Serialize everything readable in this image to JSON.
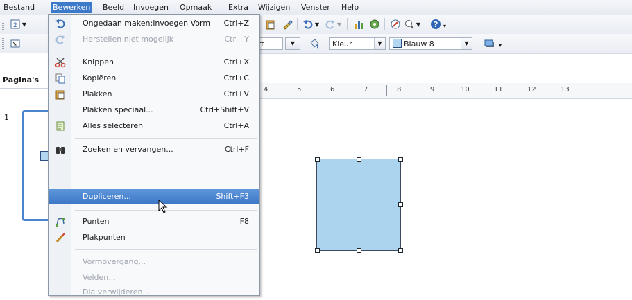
{
  "menubar": {
    "items": [
      "Bestand",
      "Bewerken",
      "Beeld",
      "Invoegen",
      "Opmaak",
      "Extra",
      "Wijzigen",
      "Venster",
      "Help"
    ]
  },
  "toolbar2": {
    "fill_style": "Kleur",
    "area_color": "Blauw 8",
    "line_style_partial": "art"
  },
  "panel": {
    "title": "Pagina's",
    "page_number": "1"
  },
  "ruler": {
    "labels": [
      "4",
      "5",
      "6",
      "7",
      "8",
      "9",
      "10",
      "11",
      "12",
      "13"
    ]
  },
  "menu": {
    "items": [
      {
        "icon": "undo-icon",
        "label": "Ongedaan maken:Invoegen Vorm",
        "shortcut": "Ctrl+Z",
        "disabled": false
      },
      {
        "icon": "redo-icon",
        "label": "Herstellen niet mogelijk",
        "shortcut": "Ctrl+Y",
        "disabled": true
      },
      {
        "icon": "scissors-icon",
        "label": "Knippen",
        "shortcut": "Ctrl+X",
        "disabled": false
      },
      {
        "icon": "copy-icon",
        "label": "Kopiëren",
        "shortcut": "Ctrl+C",
        "disabled": false
      },
      {
        "icon": "paste-icon",
        "label": "Plakken",
        "shortcut": "Ctrl+V",
        "disabled": false
      },
      {
        "icon": "",
        "label": "Plakken speciaal...",
        "shortcut": "Ctrl+Shift+V",
        "disabled": false
      },
      {
        "icon": "select-all-icon",
        "label": "Alles selecteren",
        "shortcut": "Ctrl+A",
        "disabled": false
      },
      {
        "icon": "binoculars-icon",
        "label": "Zoeken en vervangen...",
        "shortcut": "Ctrl+F",
        "disabled": false
      },
      {
        "icon": "",
        "label": "Dupliceren...",
        "shortcut": "Shift+F3",
        "disabled": false,
        "highlighted": true
      },
      {
        "icon": "points-icon",
        "label": "Punten",
        "shortcut": "F8",
        "disabled": false
      },
      {
        "icon": "glue-points-icon",
        "label": "Plakpunten",
        "shortcut": "",
        "disabled": false
      },
      {
        "icon": "",
        "label": "Vormovergang...",
        "shortcut": "",
        "disabled": true
      },
      {
        "icon": "",
        "label": "Velden...",
        "shortcut": "",
        "disabled": true
      },
      {
        "icon": "",
        "label": "Dia verwijderen...",
        "shortcut": "",
        "disabled": true
      }
    ]
  }
}
